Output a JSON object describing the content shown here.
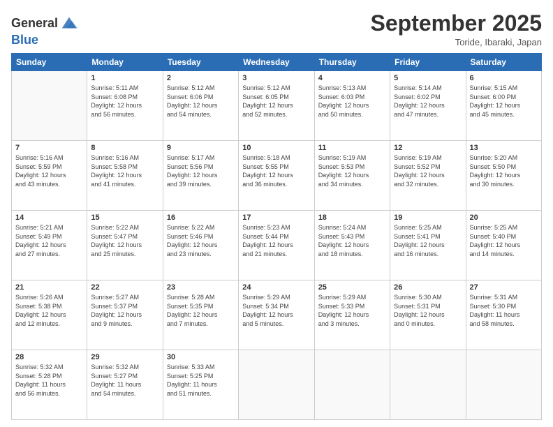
{
  "header": {
    "logo_general": "General",
    "logo_blue": "Blue",
    "month": "September 2025",
    "location": "Toride, Ibaraki, Japan"
  },
  "weekdays": [
    "Sunday",
    "Monday",
    "Tuesday",
    "Wednesday",
    "Thursday",
    "Friday",
    "Saturday"
  ],
  "weeks": [
    [
      {
        "day": "",
        "info": ""
      },
      {
        "day": "1",
        "info": "Sunrise: 5:11 AM\nSunset: 6:08 PM\nDaylight: 12 hours\nand 56 minutes."
      },
      {
        "day": "2",
        "info": "Sunrise: 5:12 AM\nSunset: 6:06 PM\nDaylight: 12 hours\nand 54 minutes."
      },
      {
        "day": "3",
        "info": "Sunrise: 5:12 AM\nSunset: 6:05 PM\nDaylight: 12 hours\nand 52 minutes."
      },
      {
        "day": "4",
        "info": "Sunrise: 5:13 AM\nSunset: 6:03 PM\nDaylight: 12 hours\nand 50 minutes."
      },
      {
        "day": "5",
        "info": "Sunrise: 5:14 AM\nSunset: 6:02 PM\nDaylight: 12 hours\nand 47 minutes."
      },
      {
        "day": "6",
        "info": "Sunrise: 5:15 AM\nSunset: 6:00 PM\nDaylight: 12 hours\nand 45 minutes."
      }
    ],
    [
      {
        "day": "7",
        "info": "Sunrise: 5:16 AM\nSunset: 5:59 PM\nDaylight: 12 hours\nand 43 minutes."
      },
      {
        "day": "8",
        "info": "Sunrise: 5:16 AM\nSunset: 5:58 PM\nDaylight: 12 hours\nand 41 minutes."
      },
      {
        "day": "9",
        "info": "Sunrise: 5:17 AM\nSunset: 5:56 PM\nDaylight: 12 hours\nand 39 minutes."
      },
      {
        "day": "10",
        "info": "Sunrise: 5:18 AM\nSunset: 5:55 PM\nDaylight: 12 hours\nand 36 minutes."
      },
      {
        "day": "11",
        "info": "Sunrise: 5:19 AM\nSunset: 5:53 PM\nDaylight: 12 hours\nand 34 minutes."
      },
      {
        "day": "12",
        "info": "Sunrise: 5:19 AM\nSunset: 5:52 PM\nDaylight: 12 hours\nand 32 minutes."
      },
      {
        "day": "13",
        "info": "Sunrise: 5:20 AM\nSunset: 5:50 PM\nDaylight: 12 hours\nand 30 minutes."
      }
    ],
    [
      {
        "day": "14",
        "info": "Sunrise: 5:21 AM\nSunset: 5:49 PM\nDaylight: 12 hours\nand 27 minutes."
      },
      {
        "day": "15",
        "info": "Sunrise: 5:22 AM\nSunset: 5:47 PM\nDaylight: 12 hours\nand 25 minutes."
      },
      {
        "day": "16",
        "info": "Sunrise: 5:22 AM\nSunset: 5:46 PM\nDaylight: 12 hours\nand 23 minutes."
      },
      {
        "day": "17",
        "info": "Sunrise: 5:23 AM\nSunset: 5:44 PM\nDaylight: 12 hours\nand 21 minutes."
      },
      {
        "day": "18",
        "info": "Sunrise: 5:24 AM\nSunset: 5:43 PM\nDaylight: 12 hours\nand 18 minutes."
      },
      {
        "day": "19",
        "info": "Sunrise: 5:25 AM\nSunset: 5:41 PM\nDaylight: 12 hours\nand 16 minutes."
      },
      {
        "day": "20",
        "info": "Sunrise: 5:25 AM\nSunset: 5:40 PM\nDaylight: 12 hours\nand 14 minutes."
      }
    ],
    [
      {
        "day": "21",
        "info": "Sunrise: 5:26 AM\nSunset: 5:38 PM\nDaylight: 12 hours\nand 12 minutes."
      },
      {
        "day": "22",
        "info": "Sunrise: 5:27 AM\nSunset: 5:37 PM\nDaylight: 12 hours\nand 9 minutes."
      },
      {
        "day": "23",
        "info": "Sunrise: 5:28 AM\nSunset: 5:35 PM\nDaylight: 12 hours\nand 7 minutes."
      },
      {
        "day": "24",
        "info": "Sunrise: 5:29 AM\nSunset: 5:34 PM\nDaylight: 12 hours\nand 5 minutes."
      },
      {
        "day": "25",
        "info": "Sunrise: 5:29 AM\nSunset: 5:33 PM\nDaylight: 12 hours\nand 3 minutes."
      },
      {
        "day": "26",
        "info": "Sunrise: 5:30 AM\nSunset: 5:31 PM\nDaylight: 12 hours\nand 0 minutes."
      },
      {
        "day": "27",
        "info": "Sunrise: 5:31 AM\nSunset: 5:30 PM\nDaylight: 11 hours\nand 58 minutes."
      }
    ],
    [
      {
        "day": "28",
        "info": "Sunrise: 5:32 AM\nSunset: 5:28 PM\nDaylight: 11 hours\nand 56 minutes."
      },
      {
        "day": "29",
        "info": "Sunrise: 5:32 AM\nSunset: 5:27 PM\nDaylight: 11 hours\nand 54 minutes."
      },
      {
        "day": "30",
        "info": "Sunrise: 5:33 AM\nSunset: 5:25 PM\nDaylight: 11 hours\nand 51 minutes."
      },
      {
        "day": "",
        "info": ""
      },
      {
        "day": "",
        "info": ""
      },
      {
        "day": "",
        "info": ""
      },
      {
        "day": "",
        "info": ""
      }
    ]
  ]
}
